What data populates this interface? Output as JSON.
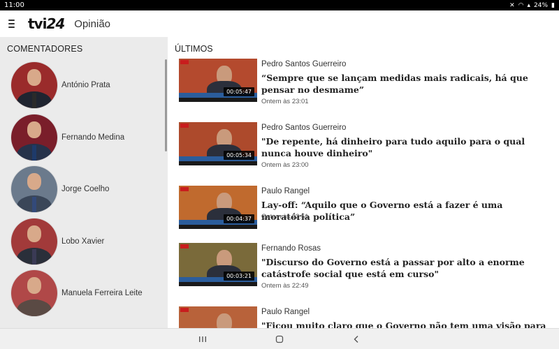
{
  "status_bar": {
    "time": "11:00",
    "battery": "24%",
    "icons": [
      "mute-icon",
      "wifi-icon",
      "signal-icon",
      "battery-icon"
    ]
  },
  "app_bar": {
    "logo_text": "tvi",
    "logo_number": "24",
    "title": "Opinião",
    "menu_icon": "menu-icon"
  },
  "sidebar": {
    "heading": "COMENTADORES",
    "items": [
      {
        "name": "António Prata",
        "bg": "#9a2b2b",
        "suit": "#1f2430",
        "tie": "#2a2a2a"
      },
      {
        "name": "Fernando Medina",
        "bg": "#7a1e2a",
        "suit": "#26324a",
        "tie": "#1e3a6a"
      },
      {
        "name": "Jorge Coelho",
        "bg": "#6b7a8c",
        "suit": "#3a4658",
        "tie": "#334a7a"
      },
      {
        "name": "Lobo Xavier",
        "bg": "#a23a3a",
        "suit": "#2a2f3a",
        "tie": "#3a3a55"
      },
      {
        "name": "Manuela Ferreira Leite",
        "bg": "#b04848",
        "suit": "#5a4a44",
        "tie": "#5a4a44"
      }
    ]
  },
  "main": {
    "heading": "ÚLTIMOS",
    "articles": [
      {
        "author": "Pedro Santos Guerreiro",
        "headline": "“Sempre que se lançam medidas mais radicais, há que pensar no desmame”",
        "time": "Ontem às 23:01",
        "duration": "00:05:47",
        "bg": "#b44a2e"
      },
      {
        "author": "Pedro Santos Guerreiro",
        "headline": "\"De repente, há dinheiro para tudo aquilo para o qual nunca houve dinheiro\"",
        "time": "Ontem às 23:00",
        "duration": "00:05:34",
        "bg": "#ad4a2c"
      },
      {
        "author": "Paulo Rangel",
        "headline": "Lay-off: “Aquilo que o Governo está a fazer é uma moratória política”",
        "time": "Ontem às 22:51",
        "duration": "00:04:37",
        "bg": "#c06a2e"
      },
      {
        "author": "Fernando Rosas",
        "headline": "\"Discurso do Governo está a passar por alto a enorme catástrofe social que está em curso\"",
        "time": "Ontem às 22:49",
        "duration": "00:03:21",
        "bg": "#7a6a3a"
      },
      {
        "author": "Paulo Rangel",
        "headline": "\"Ficou muito claro que o Governo não tem uma visão para o país\"",
        "time": "",
        "duration": "",
        "bg": "#b8623a"
      }
    ]
  },
  "nav_bar": {
    "recent_icon": "recent-apps-icon",
    "home_icon": "home-icon",
    "back_icon": "back-icon"
  }
}
